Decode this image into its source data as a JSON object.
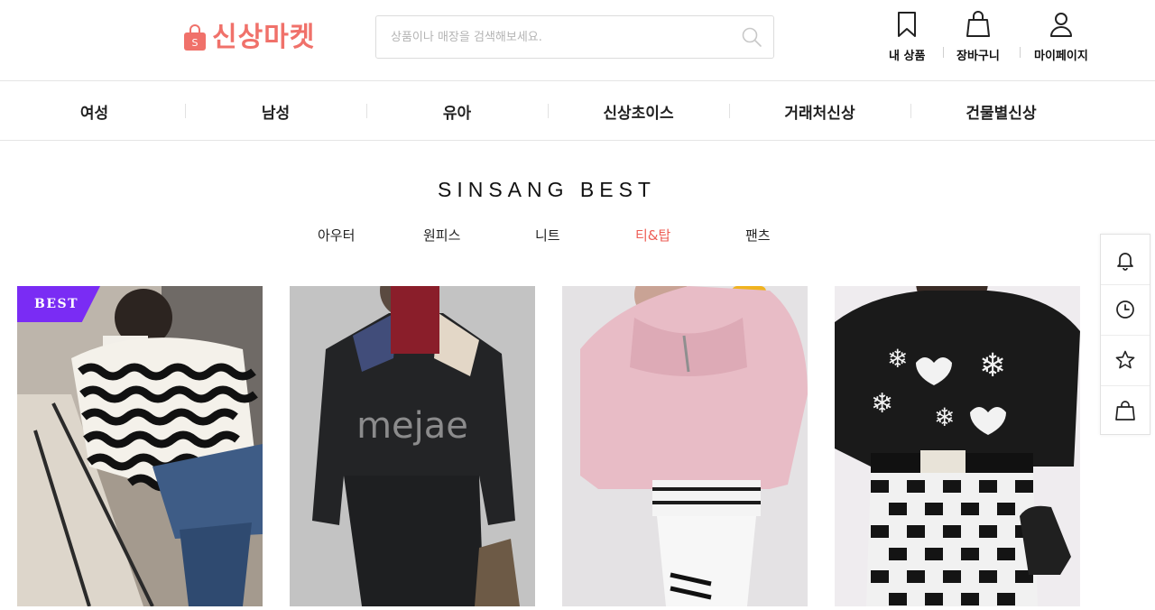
{
  "header": {
    "logo_text": "신상마켓",
    "logo_bag_letter": "S",
    "brand_color": "#f0716a",
    "search": {
      "placeholder": "상품이나 매장을 검색해보세요.",
      "value": ""
    },
    "utils": [
      {
        "label": "내 상품",
        "icon": "bookmark-icon"
      },
      {
        "label": "장바구니",
        "icon": "shopping-bag-icon"
      },
      {
        "label": "마이페이지",
        "icon": "user-icon"
      }
    ]
  },
  "categories": [
    "여성",
    "남성",
    "유아",
    "신상초이스",
    "거래처신상",
    "건물별신상"
  ],
  "best": {
    "title": "SINSANG BEST",
    "tabs": [
      "아우터",
      "원피스",
      "니트",
      "티&탑",
      "팬츠"
    ],
    "active_tab": "티&탑",
    "active_color": "#ee5d55",
    "badge": "BEST",
    "badge_color": "#7a2cf4"
  },
  "products": [
    {
      "image": "black-white-wave-knit-sweater-photo"
    },
    {
      "image": "black-turtleneck-knit-photo",
      "watermark": "mejae"
    },
    {
      "image": "pink-fleece-hoodie-photo"
    },
    {
      "image": "black-snowflake-sweatshirt-photo"
    }
  ],
  "quickbar": [
    {
      "icon": "bell-icon"
    },
    {
      "icon": "clock-icon"
    },
    {
      "icon": "star-icon"
    },
    {
      "icon": "shopping-bag-icon"
    }
  ]
}
